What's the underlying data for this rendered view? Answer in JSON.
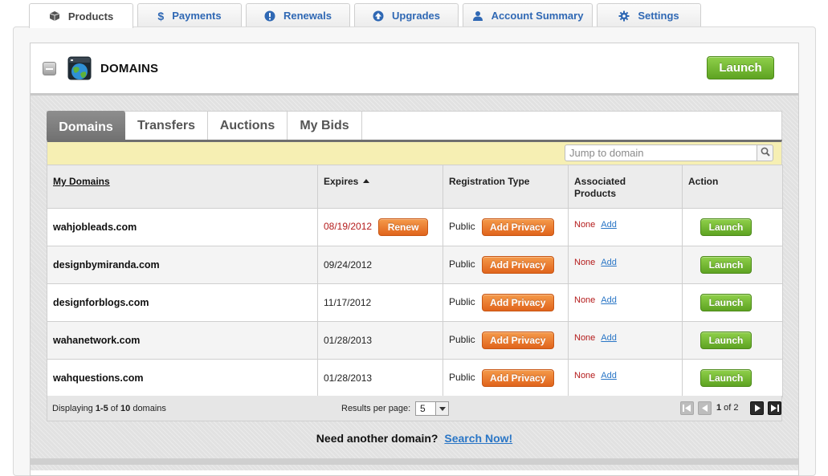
{
  "nav": {
    "tabs": [
      {
        "label": "Products",
        "icon": "box-icon",
        "active": true
      },
      {
        "label": "Payments",
        "icon": "dollar-icon",
        "active": false
      },
      {
        "label": "Renewals",
        "icon": "alert-icon",
        "active": false
      },
      {
        "label": "Upgrades",
        "icon": "upload-arrow-icon",
        "active": false
      },
      {
        "label": "Account Summary",
        "icon": "user-icon",
        "active": false
      },
      {
        "label": "Settings",
        "icon": "gear-icon",
        "active": false
      }
    ]
  },
  "panel": {
    "title": "DOMAINS",
    "launch_label": "Launch"
  },
  "subtabs": [
    "Domains",
    "Transfers",
    "Auctions",
    "My Bids"
  ],
  "search": {
    "placeholder": "Jump to domain"
  },
  "table": {
    "headers": {
      "domain": "My Domains",
      "expires": "Expires",
      "regtype": "Registration Type",
      "assoc": "Associated Products",
      "action": "Action"
    },
    "rows": [
      {
        "domain": "wahjobleads.com",
        "expires": "08/19/2012",
        "expired": true,
        "renew_label": "Renew",
        "reg": "Public",
        "privacy_label": "Add Privacy",
        "assoc": "None",
        "add_label": "Add",
        "launch_label": "Launch"
      },
      {
        "domain": "designbymiranda.com",
        "expires": "09/24/2012",
        "expired": false,
        "reg": "Public",
        "privacy_label": "Add Privacy",
        "assoc": "None",
        "add_label": "Add",
        "launch_label": "Launch"
      },
      {
        "domain": "designforblogs.com",
        "expires": "11/17/2012",
        "expired": false,
        "reg": "Public",
        "privacy_label": "Add Privacy",
        "assoc": "None",
        "add_label": "Add",
        "launch_label": "Launch"
      },
      {
        "domain": "wahanetwork.com",
        "expires": "01/28/2013",
        "expired": false,
        "reg": "Public",
        "privacy_label": "Add Privacy",
        "assoc": "None",
        "add_label": "Add",
        "launch_label": "Launch"
      },
      {
        "domain": "wahquestions.com",
        "expires": "01/28/2013",
        "expired": false,
        "reg": "Public",
        "privacy_label": "Add Privacy",
        "assoc": "None",
        "add_label": "Add",
        "launch_label": "Launch"
      }
    ]
  },
  "footer": {
    "displaying_prefix": "Displaying ",
    "range": "1-5",
    "of": " of ",
    "total": "10",
    "suffix": " domains",
    "results_per_page_label": "Results per page:",
    "results_per_page": "5",
    "page_current": "1",
    "page_of": " of ",
    "page_total": "2"
  },
  "prompt": {
    "text": "Need another domain?",
    "link": "Search Now!"
  },
  "colors": {
    "accent_blue": "#2f68b4",
    "launch_green": "#6bb52c",
    "action_orange": "#e8762c",
    "expired_red": "#b41b1b",
    "filter_yellow": "#f6efb3"
  }
}
